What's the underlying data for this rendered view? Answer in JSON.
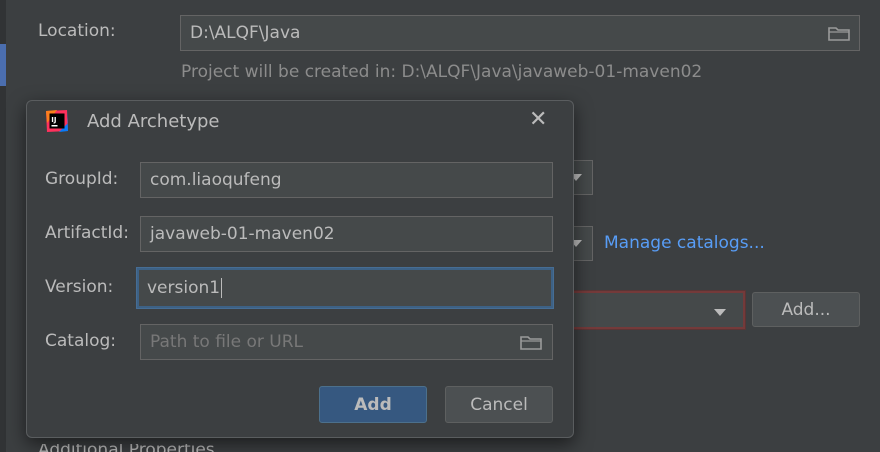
{
  "background": {
    "location_label": "Location:",
    "location_value": "D:\\ALQF\\Java",
    "project_hint": "Project will be created in: D:\\ALQF\\Java\\javaweb-01-maven02",
    "manage_catalogs_link": "Manage catalogs...",
    "add_button": "Add...",
    "partial_label": "Additional Properties"
  },
  "dialog": {
    "title": "Add Archetype",
    "logo_text": "IJ",
    "fields": {
      "group_id": {
        "label": "GroupId:",
        "value": "com.liaoqufeng"
      },
      "artifact_id": {
        "label": "ArtifactId:",
        "value": "javaweb-01-maven02"
      },
      "version": {
        "label": "Version:",
        "value": "version1"
      },
      "catalog": {
        "label": "Catalog:",
        "placeholder": "Path to file or URL"
      }
    },
    "buttons": {
      "add": "Add",
      "cancel": "Cancel"
    }
  },
  "colors": {
    "background": "#3c3f41",
    "field": "#45494a",
    "accent_blue": "#365880",
    "link": "#589df6",
    "error_border": "#743a3a"
  }
}
